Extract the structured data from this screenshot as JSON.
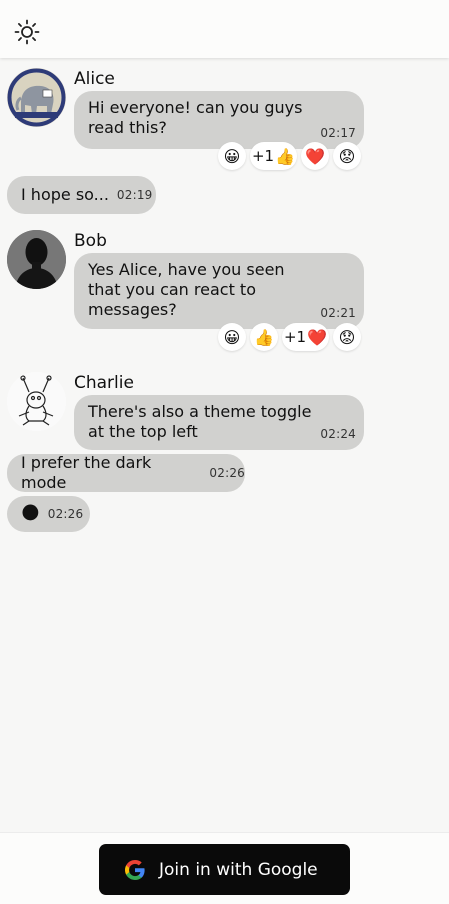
{
  "theme_toggle": {
    "icon": "sun-icon"
  },
  "messages": [
    {
      "author": "Alice",
      "text": "Hi everyone! can you guys read this?",
      "time": "02:17",
      "reactions": [
        {
          "emoji": "😀",
          "count": ""
        },
        {
          "emoji": "👍",
          "count": "+1"
        },
        {
          "emoji": "❤️",
          "count": ""
        },
        {
          "emoji": "😟",
          "count": ""
        }
      ]
    },
    {
      "author": "",
      "text": "I hope so...",
      "time": "02:19"
    },
    {
      "author": "Bob",
      "text": "Yes Alice, have you seen that you can react to messages?",
      "time": "02:21",
      "reactions": [
        {
          "emoji": "😀",
          "count": ""
        },
        {
          "emoji": "👍",
          "count": ""
        },
        {
          "emoji": "❤️",
          "count": "+1"
        },
        {
          "emoji": "😟",
          "count": ""
        }
      ]
    },
    {
      "author": "Charlie",
      "text": "There's also a theme toggle at the top left",
      "time": "02:24"
    },
    {
      "author": "",
      "text": "I prefer the dark mode",
      "time": "02:26"
    },
    {
      "author": "",
      "text": "",
      "emoji": "🌑",
      "time": "02:26"
    }
  ],
  "bottom": {
    "login_label": "Join in with Google"
  },
  "colors": {
    "bubble": "#d1d1cf",
    "button_bg": "#0a0a0a",
    "page_bg": "#f7f7f6"
  }
}
